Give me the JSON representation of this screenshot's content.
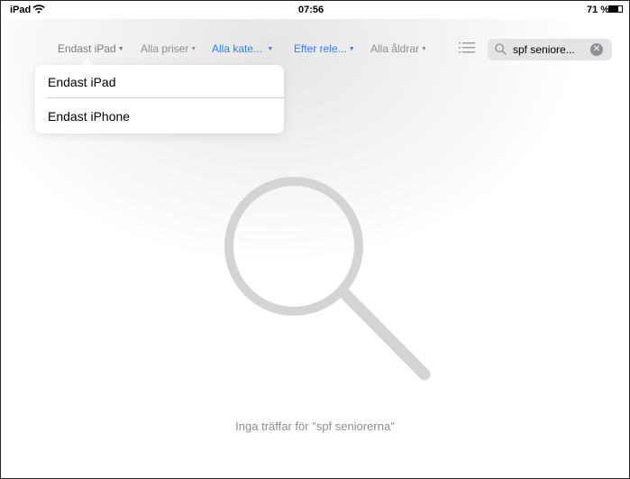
{
  "status_bar": {
    "device": "iPad",
    "time": "07:56",
    "battery_percent": "71 %",
    "battery_level": 0.71
  },
  "filters": {
    "device": "Endast iPad",
    "price": "Alla priser",
    "category": "Alla kate...",
    "sort": "Efter rele...",
    "age": "Alla åldrar",
    "caret": "▼"
  },
  "search": {
    "query": "spf seniore...",
    "clear_glyph": "✕"
  },
  "device_menu": {
    "items": [
      {
        "label": "Endast iPad"
      },
      {
        "label": "Endast iPhone"
      }
    ]
  },
  "empty_state": {
    "message": "Inga träffar för \"spf seniorerna\""
  },
  "colors": {
    "accent": "#2f7cf6",
    "gray_text": "#8e8e93",
    "magnifier": "#d4d4d4"
  },
  "icons": [
    "wifi-icon",
    "battery-icon",
    "list-icon",
    "search-icon",
    "clear-icon",
    "magnifier-icon"
  ]
}
